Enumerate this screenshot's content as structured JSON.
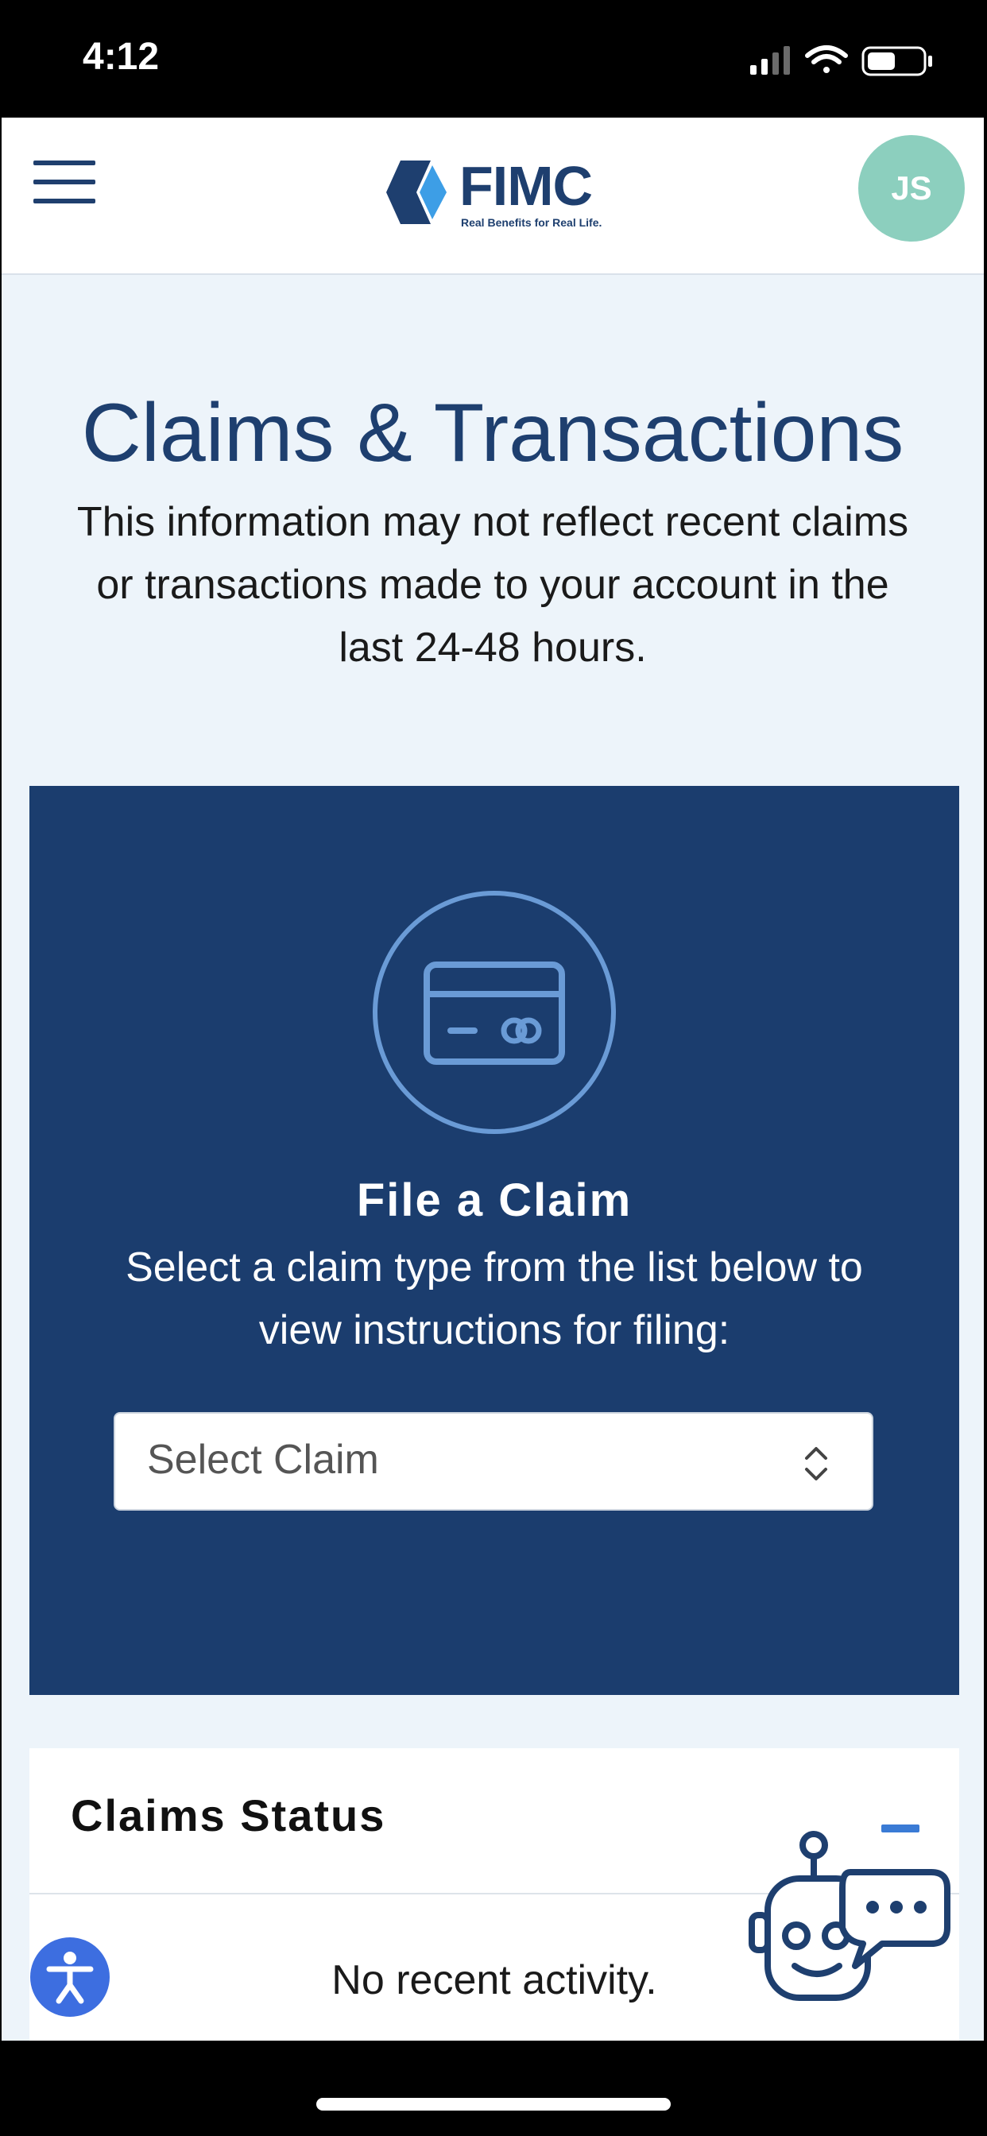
{
  "status_bar": {
    "time": "4:12"
  },
  "header": {
    "logo_text": "FIMC",
    "logo_tagline": "Real Benefits for Real Life.",
    "avatar_initials": "JS"
  },
  "page": {
    "title": "Claims & Transactions",
    "subtitle": "This information may not reflect recent claims or transactions made to your account in the last 24-48 hours."
  },
  "file_claim": {
    "title": "File a Claim",
    "description": "Select a claim type from the list below to view instructions for filing:",
    "select_value": "Select Claim"
  },
  "claims_status": {
    "title": "Claims Status",
    "empty_message": "No recent activity."
  },
  "colors": {
    "primary": "#1e3f6f",
    "card_blue": "#1b3d6e",
    "avatar": "#8ccfbe",
    "accent": "#3a7bd5",
    "background": "#edf4fa"
  }
}
